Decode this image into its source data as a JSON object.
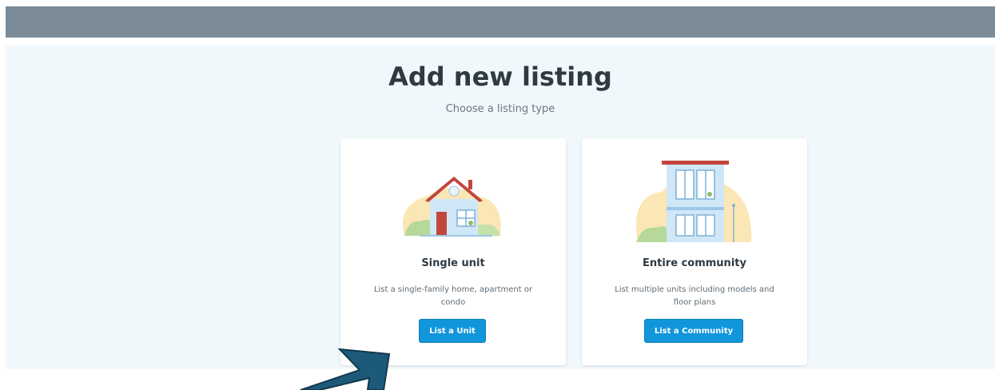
{
  "page": {
    "title": "Add new listing",
    "subtitle": "Choose a listing type"
  },
  "cards": [
    {
      "title": "Single unit",
      "description": "List a single-family home, apartment or condo",
      "button_label": "List a Unit",
      "illustration_icon": "house-illustration-icon"
    },
    {
      "title": "Entire community",
      "description": "List multiple units including models and floor plans",
      "button_label": "List a Community",
      "illustration_icon": "apartment-building-illustration-icon"
    }
  ],
  "colors": {
    "top_bar": "#7b8b98",
    "background": "#f0f8fc",
    "button": "#1296db",
    "arrow": "#1d5a7a"
  }
}
